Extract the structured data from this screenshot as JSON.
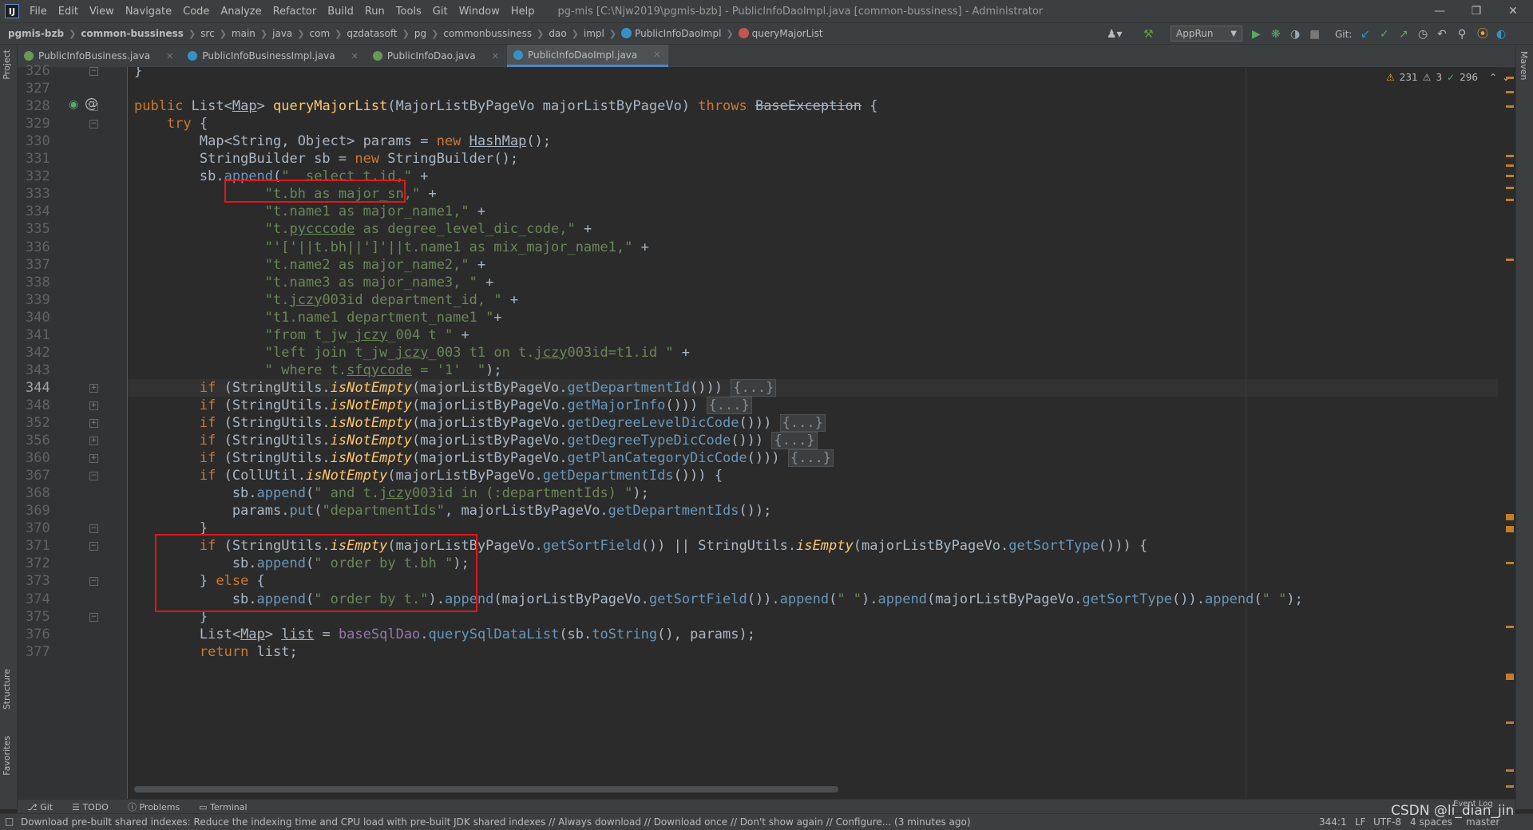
{
  "app": {
    "logo": "IJ",
    "window_title": "pg-mis [C:\\Njw2019\\pgmis-bzb] - PublicInfoDaoImpl.java [common-bussiness] - Administrator"
  },
  "menu": [
    "File",
    "Edit",
    "View",
    "Navigate",
    "Code",
    "Analyze",
    "Refactor",
    "Build",
    "Run",
    "Tools",
    "Git",
    "Window",
    "Help"
  ],
  "breadcrumbs": [
    "pgmis-bzb",
    "common-bussiness",
    "src",
    "main",
    "java",
    "com",
    "qzdatasoft",
    "pg",
    "commonbussiness",
    "dao",
    "impl",
    "PublicInfoDaoImpl",
    "queryMajorList"
  ],
  "toolbar": {
    "run_config": "AppRun",
    "git_label": "Git:"
  },
  "tabs": [
    {
      "label": "PublicInfoBusiness.java",
      "icon": "interface-icon",
      "color": "#6a9955",
      "active": false
    },
    {
      "label": "PublicInfoBusinessImpl.java",
      "icon": "class-icon",
      "color": "#3592c4",
      "active": false
    },
    {
      "label": "PublicInfoDao.java",
      "icon": "interface-icon",
      "color": "#6a9955",
      "active": false
    },
    {
      "label": "PublicInfoDaoImpl.java",
      "icon": "class-icon",
      "color": "#3592c4",
      "active": true
    }
  ],
  "inspection": {
    "warnings": "231",
    "weak_warnings": "3",
    "ok": "296"
  },
  "side_labels": {
    "project": "Project",
    "structure": "Structure",
    "favorites": "Favorites",
    "maven": "Maven"
  },
  "code": {
    "current_line": "344",
    "lines": [
      {
        "num": "326",
        "html": "}"
      },
      {
        "num": "327",
        "html": ""
      },
      {
        "num": "328",
        "html": "<span class='kw'>public</span> List&lt;<u>Map</u>&gt; <span class='fn'>queryMajorList</span>(MajorListByPageVo majorListByPageVo) <span class='kw'>throws</span> <s>BaseException</s> {"
      },
      {
        "num": "329",
        "html": "    <span class='kw'>try</span> {"
      },
      {
        "num": "330",
        "html": "        Map&lt;String, Object&gt; params = <span class='kw'>new</span> <u>HashMap</u>();"
      },
      {
        "num": "331",
        "html": "        StringBuilder sb = <span class='kw'>new</span> StringBuilder();"
      },
      {
        "num": "332",
        "html": "        sb.<span class='mcall'>append</span>(<span class='str'>\"  select t.id,\"</span> +"
      },
      {
        "num": "333",
        "html": "                <span class='str'>\"t.bh as major_sn,\"</span> +"
      },
      {
        "num": "334",
        "html": "                <span class='str'>\"t.name1 as major_name1,\"</span> +"
      },
      {
        "num": "335",
        "html": "                <span class='str'>\"t.<u>pycccode</u> as degree_level_dic_code,\"</span> +"
      },
      {
        "num": "336",
        "html": "                <span class='str'>\"'['||t.bh||']'||t.name1 as mix_major_name1,\"</span> +"
      },
      {
        "num": "337",
        "html": "                <span class='str'>\"t.name2 as major_name2,\"</span> +"
      },
      {
        "num": "338",
        "html": "                <span class='str'>\"t.name3 as major_name3, \"</span> +"
      },
      {
        "num": "339",
        "html": "                <span class='str'>\"t.<u>jczy</u>003id department_id, \"</span> +"
      },
      {
        "num": "340",
        "html": "                <span class='str'>\"t1.name1 department_name1 \"</span>+"
      },
      {
        "num": "341",
        "html": "                <span class='str'>\"from t_jw_<u>jczy</u>_004 t \"</span> +"
      },
      {
        "num": "342",
        "html": "                <span class='str'>\"left join t_jw_<u>jczy</u>_003 t1 on t.<u>jczy</u>003id=t1.id \"</span> +"
      },
      {
        "num": "343",
        "html": "                <span class='str'>\" where t.<u>sfqycode</u> = '1'  \"</span>);"
      },
      {
        "num": "344",
        "html": "        <span class='kw'>if</span> (StringUtils.<span class='stat-m'>isNotEmpty</span>(majorListByPageVo.<span class='mcall'>getDepartmentId</span>())) <span class='fold-body'>{...}</span>"
      },
      {
        "num": "348",
        "html": "        <span class='kw'>if</span> (StringUtils.<span class='stat-m'>isNotEmpty</span>(majorListByPageVo.<span class='mcall'>getMajorInfo</span>())) <span class='fold-body'>{...}</span>"
      },
      {
        "num": "352",
        "html": "        <span class='kw'>if</span> (StringUtils.<span class='stat-m'>isNotEmpty</span>(majorListByPageVo.<span class='mcall'>getDegreeLevelDicCode</span>())) <span class='fold-body'>{...}</span>"
      },
      {
        "num": "356",
        "html": "        <span class='kw'>if</span> (StringUtils.<span class='stat-m'>isNotEmpty</span>(majorListByPageVo.<span class='mcall'>getDegreeTypeDicCode</span>())) <span class='fold-body'>{...}</span>"
      },
      {
        "num": "360",
        "html": "        <span class='kw'>if</span> (StringUtils.<span class='stat-m'>isNotEmpty</span>(majorListByPageVo.<span class='mcall'>getPlanCategoryDicCode</span>())) <span class='fold-body'>{...}</span>"
      },
      {
        "num": "367",
        "html": "        <span class='kw'>if</span> (CollUtil.<span class='stat-m'>isNotEmpty</span>(majorListByPageVo.<span class='mcall'>getDepartmentIds</span>())) {"
      },
      {
        "num": "368",
        "html": "            sb.<span class='mcall'>append</span>(<span class='str'>\" and t.<u>jczy</u>003id in (:departmentIds) \"</span>);"
      },
      {
        "num": "369",
        "html": "            params.<span class='mcall'>put</span>(<span class='str'>\"departmentIds\"</span>, majorListByPageVo.<span class='mcall'>getDepartmentIds</span>());"
      },
      {
        "num": "370",
        "html": "        }"
      },
      {
        "num": "371",
        "html": "        <span class='kw'>if</span> (StringUtils.<span class='stat-m'>isEmpty</span>(majorListByPageVo.<span class='mcall'>getSortField</span>()) || StringUtils.<span class='stat-m'>isEmpty</span>(majorListByPageVo.<span class='mcall'>getSortType</span>())) {"
      },
      {
        "num": "372",
        "html": "            sb.<span class='mcall'>append</span>(<span class='str'>\" order by t.bh \"</span>);"
      },
      {
        "num": "373",
        "html": "        } <span class='kw'>else</span> {"
      },
      {
        "num": "374",
        "html": "            sb.<span class='mcall'>append</span>(<span class='str'>\" order by t.\"</span>).<span class='mcall'>append</span>(majorListByPageVo.<span class='mcall'>getSortField</span>()).<span class='mcall'>append</span>(<span class='str'>\" \"</span>).<span class='mcall'>append</span>(majorListByPageVo.<span class='mcall'>getSortType</span>()).<span class='mcall'>append</span>(<span class='str'>\" \"</span>);"
      },
      {
        "num": "375",
        "html": "        }"
      },
      {
        "num": "376",
        "html": "        List&lt;<u>Map</u>&gt; <u>list</u> = <span class='fld'>baseSqlDao</span>.<span class='mcall'>querySqlDataList</span>(sb.<span class='mcall'>toString</span>(), params);"
      },
      {
        "num": "377",
        "html": "        <span class='kw'>return</span> list;"
      }
    ]
  },
  "tool_tabs": [
    "Git",
    "TODO",
    "Problems",
    "Terminal"
  ],
  "status": {
    "message": "Download pre-built shared indexes: Reduce the indexing time and CPU load with pre-built JDK shared indexes // Always download // Download once // Don't show again // Configure... (3 minutes ago)",
    "position": "344:1",
    "line_sep": "LF",
    "encoding": "UTF-8",
    "indent": "4 spaces",
    "branch": "master",
    "event_log": "Event Log"
  },
  "watermark": "CSDN @li_dian_jin"
}
